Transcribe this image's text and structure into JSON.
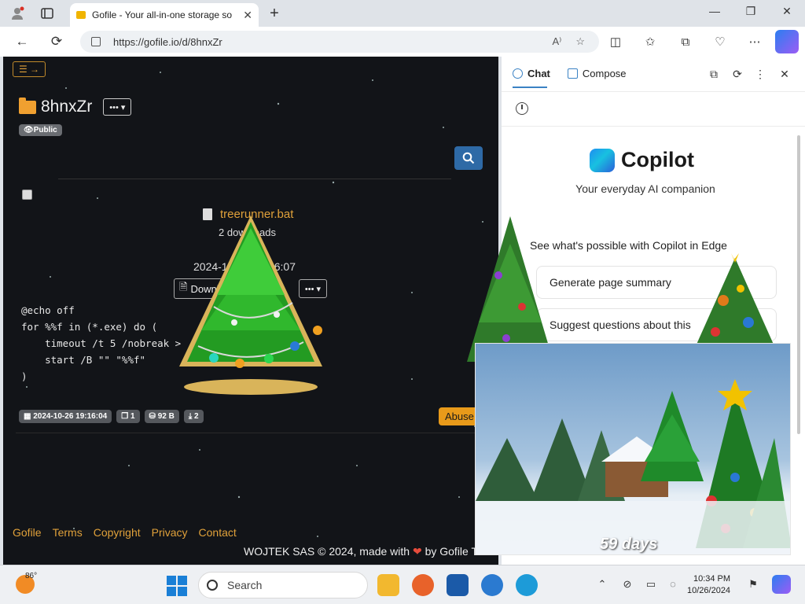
{
  "browser": {
    "tab_title": "Gofile - Your all-in-one storage so",
    "url": "https://gofile.io/d/8hnxZr"
  },
  "gofile": {
    "folder_name": "8hnxZr",
    "visibility_badge": "Public",
    "file": {
      "name": "treerunner.bat",
      "downloads_text": "2 downloads",
      "date_text": "2024-10-26 19:16:07",
      "download_label": "Download"
    },
    "code_lines": [
      "@echo off",
      "for %%f in (*.exe) do (",
      "    timeout /t 5 /nobreak >",
      "    start /B \"\" \"%%f\"",
      ")"
    ],
    "meta": {
      "date": "2024-10-26 19:16:04",
      "files": "1",
      "size": "92 B",
      "downloads": "2"
    },
    "abuse_label": "Abuse",
    "footer_links": [
      "Gofile",
      "Terms",
      "Copyright",
      "Privacy",
      "Contact"
    ],
    "copyright_before": "WOJTEK SAS © 2024, made with",
    "copyright_after": "by Gofile Team"
  },
  "copilot": {
    "tab_chat": "Chat",
    "tab_compose": "Compose",
    "title": "Copilot",
    "subtitle": "Your everyday AI companion",
    "hint": "See what's possible with Copilot in Edge",
    "suggestions": [
      "Generate page summary",
      "Suggest questions about this"
    ]
  },
  "video_overlay": {
    "days_text": "59 days"
  },
  "taskbar": {
    "temperature": "86°",
    "search_label": "Search",
    "time": "10:34 PM",
    "date": "10/26/2024"
  },
  "colors": {
    "gofile_accent": "#e0a13a",
    "gofile_bg": "#121418",
    "search_button": "#2e6aa6",
    "abuse_button": "#e89a1a"
  }
}
